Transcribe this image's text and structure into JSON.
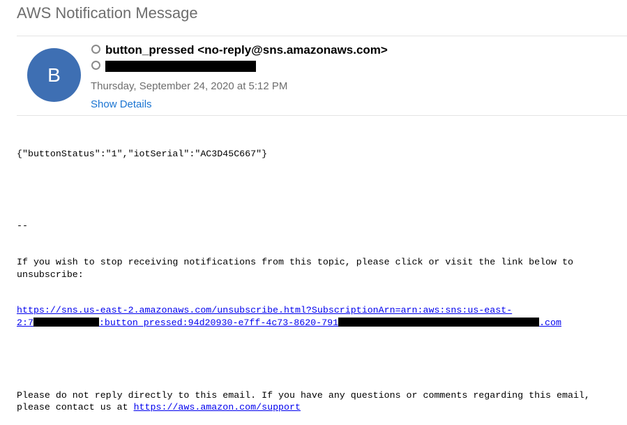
{
  "email": {
    "subject": "AWS Notification Message",
    "avatar_initial": "B",
    "sender": "button_pressed <no-reply@sns.amazonaws.com>",
    "date": "Thursday, September 24, 2020 at 5:12 PM",
    "show_details": "Show Details"
  },
  "body": {
    "json_line": "{\"buttonStatus\":\"1\",\"iotSerial\":\"AC3D45C667\"}",
    "separator": "--",
    "unsubscribe_text": "If you wish to stop receiving notifications from this topic, please click or visit the link below to unsubscribe:",
    "unsubscribe_link_line1": "https://sns.us-east-2.amazonaws.com/unsubscribe.html?SubscriptionArn=arn:aws:sns:us-east-",
    "unsubscribe_link_part_a": "2:7",
    "unsubscribe_link_part_b": ":button_pressed:94d20930-e7ff-4c73-8620-791",
    "unsubscribe_link_part_c": ".com",
    "reply_text": "Please do not reply directly to this email. If you have any questions or comments regarding this email, please contact us at ",
    "support_link": "https://aws.amazon.com/support"
  }
}
